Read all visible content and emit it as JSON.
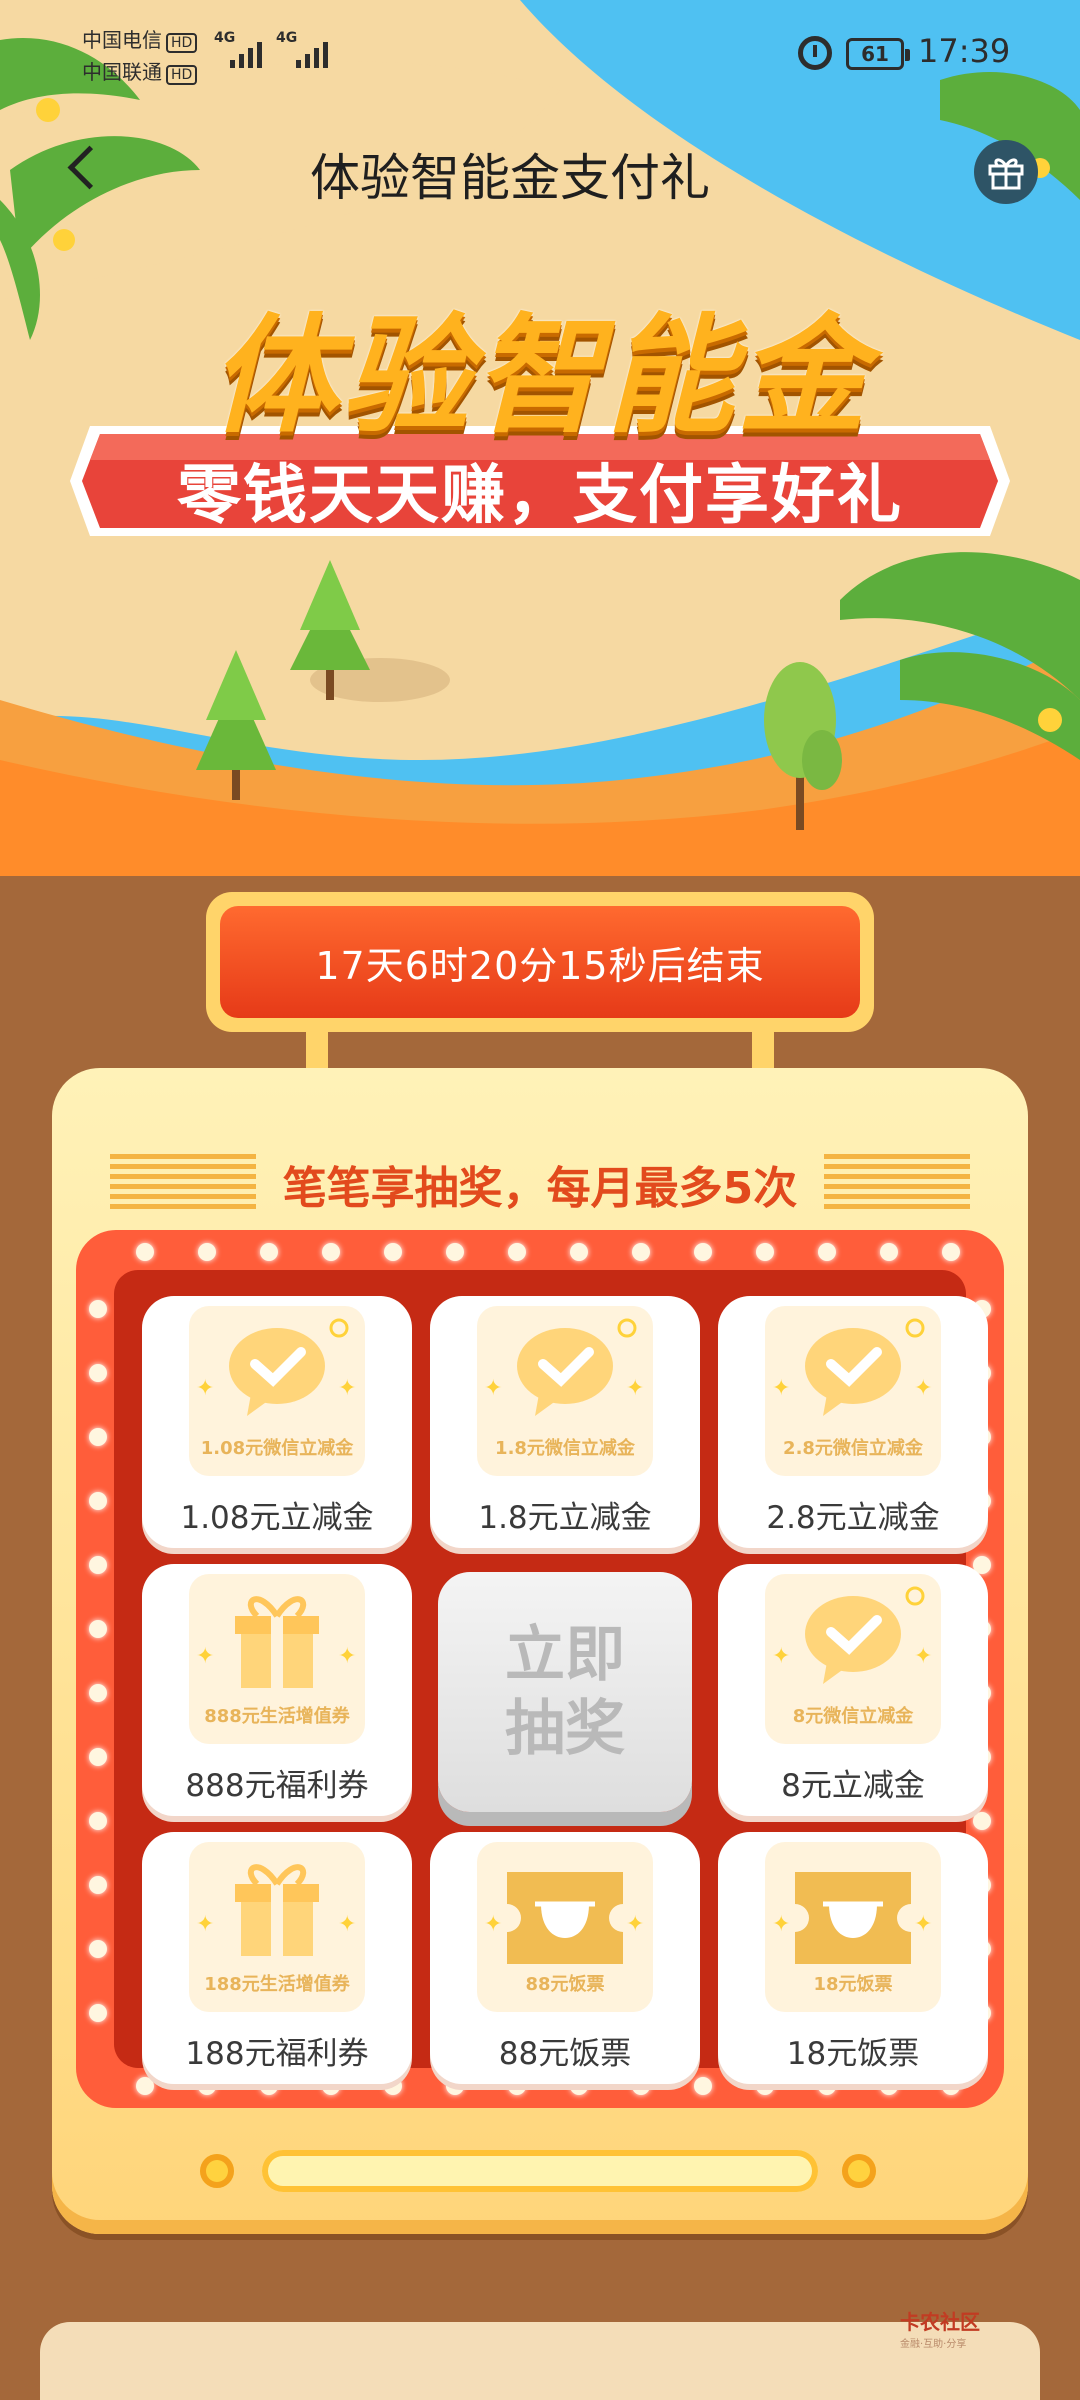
{
  "status_bar": {
    "carrier_1": "中国电信",
    "carrier_2": "中国联通",
    "hd": "HD",
    "net_1": "4G",
    "net_2": "4G",
    "battery": "61",
    "time": "17:39"
  },
  "nav": {
    "title": "体验智能金支付礼"
  },
  "banner": {
    "title": "体验智能金",
    "subtitle": "零钱天天赚，支付享好礼"
  },
  "timer": {
    "text": "17天6时20分15秒后结束"
  },
  "lottery": {
    "slogan": "笔笔享抽奖，每月最多5次",
    "draw_button": "立即\n抽奖",
    "prizes": [
      {
        "name": "1.08元立减金",
        "pic_label": "1.08元微信立减金",
        "icon": "wechat-pay-icon"
      },
      {
        "name": "1.8元立减金",
        "pic_label": "1.8元微信立减金",
        "icon": "wechat-pay-icon"
      },
      {
        "name": "2.8元立减金",
        "pic_label": "2.8元微信立减金",
        "icon": "wechat-pay-icon"
      },
      {
        "name": "888元福利券",
        "pic_label": "888元生活增值券",
        "icon": "gift-box-icon"
      },
      {
        "name": "8元立减金",
        "pic_label": "8元微信立减金",
        "icon": "wechat-pay-icon"
      },
      {
        "name": "188元福利券",
        "pic_label": "188元生活增值券",
        "icon": "gift-box-icon"
      },
      {
        "name": "88元饭票",
        "pic_label": "88元饭票",
        "icon": "meal-ticket-icon"
      },
      {
        "name": "18元饭票",
        "pic_label": "18元饭票",
        "icon": "meal-ticket-icon"
      }
    ]
  },
  "watermark": {
    "title": "卡农社区",
    "sub": "金融·互助·分享"
  },
  "colors": {
    "sky": "#4fc1f2",
    "sand": "#f5d9a3",
    "ground": "#a4683a",
    "accent": "#e63a18",
    "gold": "#ffb21e"
  }
}
